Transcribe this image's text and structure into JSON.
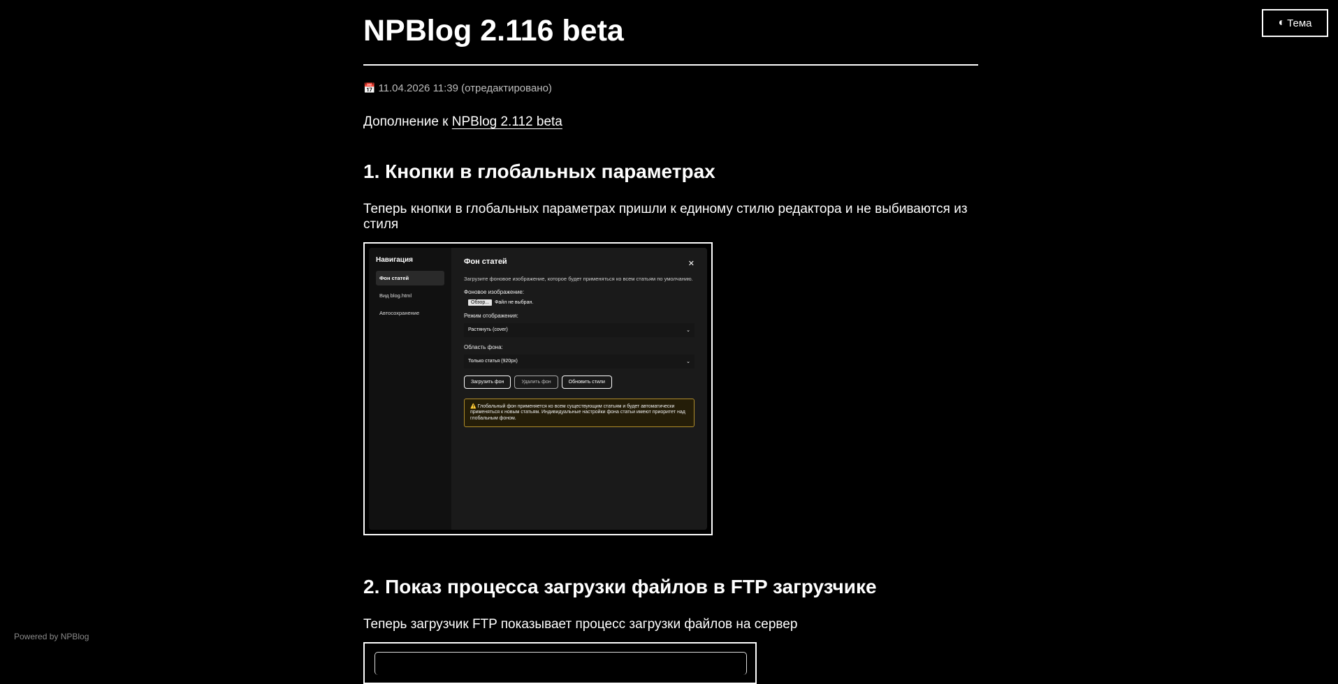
{
  "theme_button": {
    "icon": "half-moon-icon",
    "label": "Тема"
  },
  "post": {
    "title": "NPBlog 2.116 beta",
    "meta_icon": "📅",
    "date": "11.04.2026 11:39 (отредактировано)",
    "lead_prefix": "Дополнение к",
    "lead_link": "NPBlog 2.112 beta"
  },
  "section1": {
    "heading": "1. Кнопки в глобальных параметрах",
    "text": "Теперь кнопки в глобальных параметрах пришли к единому стилю редактора и не выбиваются из стиля",
    "screenshot": {
      "nav_title": "Навигация",
      "nav_items": [
        "Фон статей",
        "Вид blog.html",
        "Автосохранение"
      ],
      "panel_title": "Фон статей",
      "close": "✕",
      "description": "Загрузите фоновое изображение, которое будет применяться ко всем статьям по умолчанию.",
      "bg_image_label": "Фоновое изображение:",
      "browse": "Обзор...",
      "no_file": "Файл не выбран.",
      "mode_label": "Режим отображения:",
      "mode_value": "Растянуть (cover)",
      "area_label": "Область фона:",
      "area_value": "Только статья (920px)",
      "chevron": "⌄",
      "buttons": [
        "Загрузить фон",
        "Удалить фон",
        "Обновить стили"
      ],
      "warning": "⚠️ Глобальный фон применяется ко всем существующим статьям и будет автоматически применяться к новым статьям. Индивидуальные настройки фона статьи имеют приоритет над глобальным фоном."
    }
  },
  "section2": {
    "heading": "2. Показ процесса загрузки файлов в FTP загрузчике",
    "text": "Теперь загрузчик FTP показывает процесс загрузки файлов на сервер"
  },
  "footer": {
    "text": "Powered by NPBlog"
  }
}
